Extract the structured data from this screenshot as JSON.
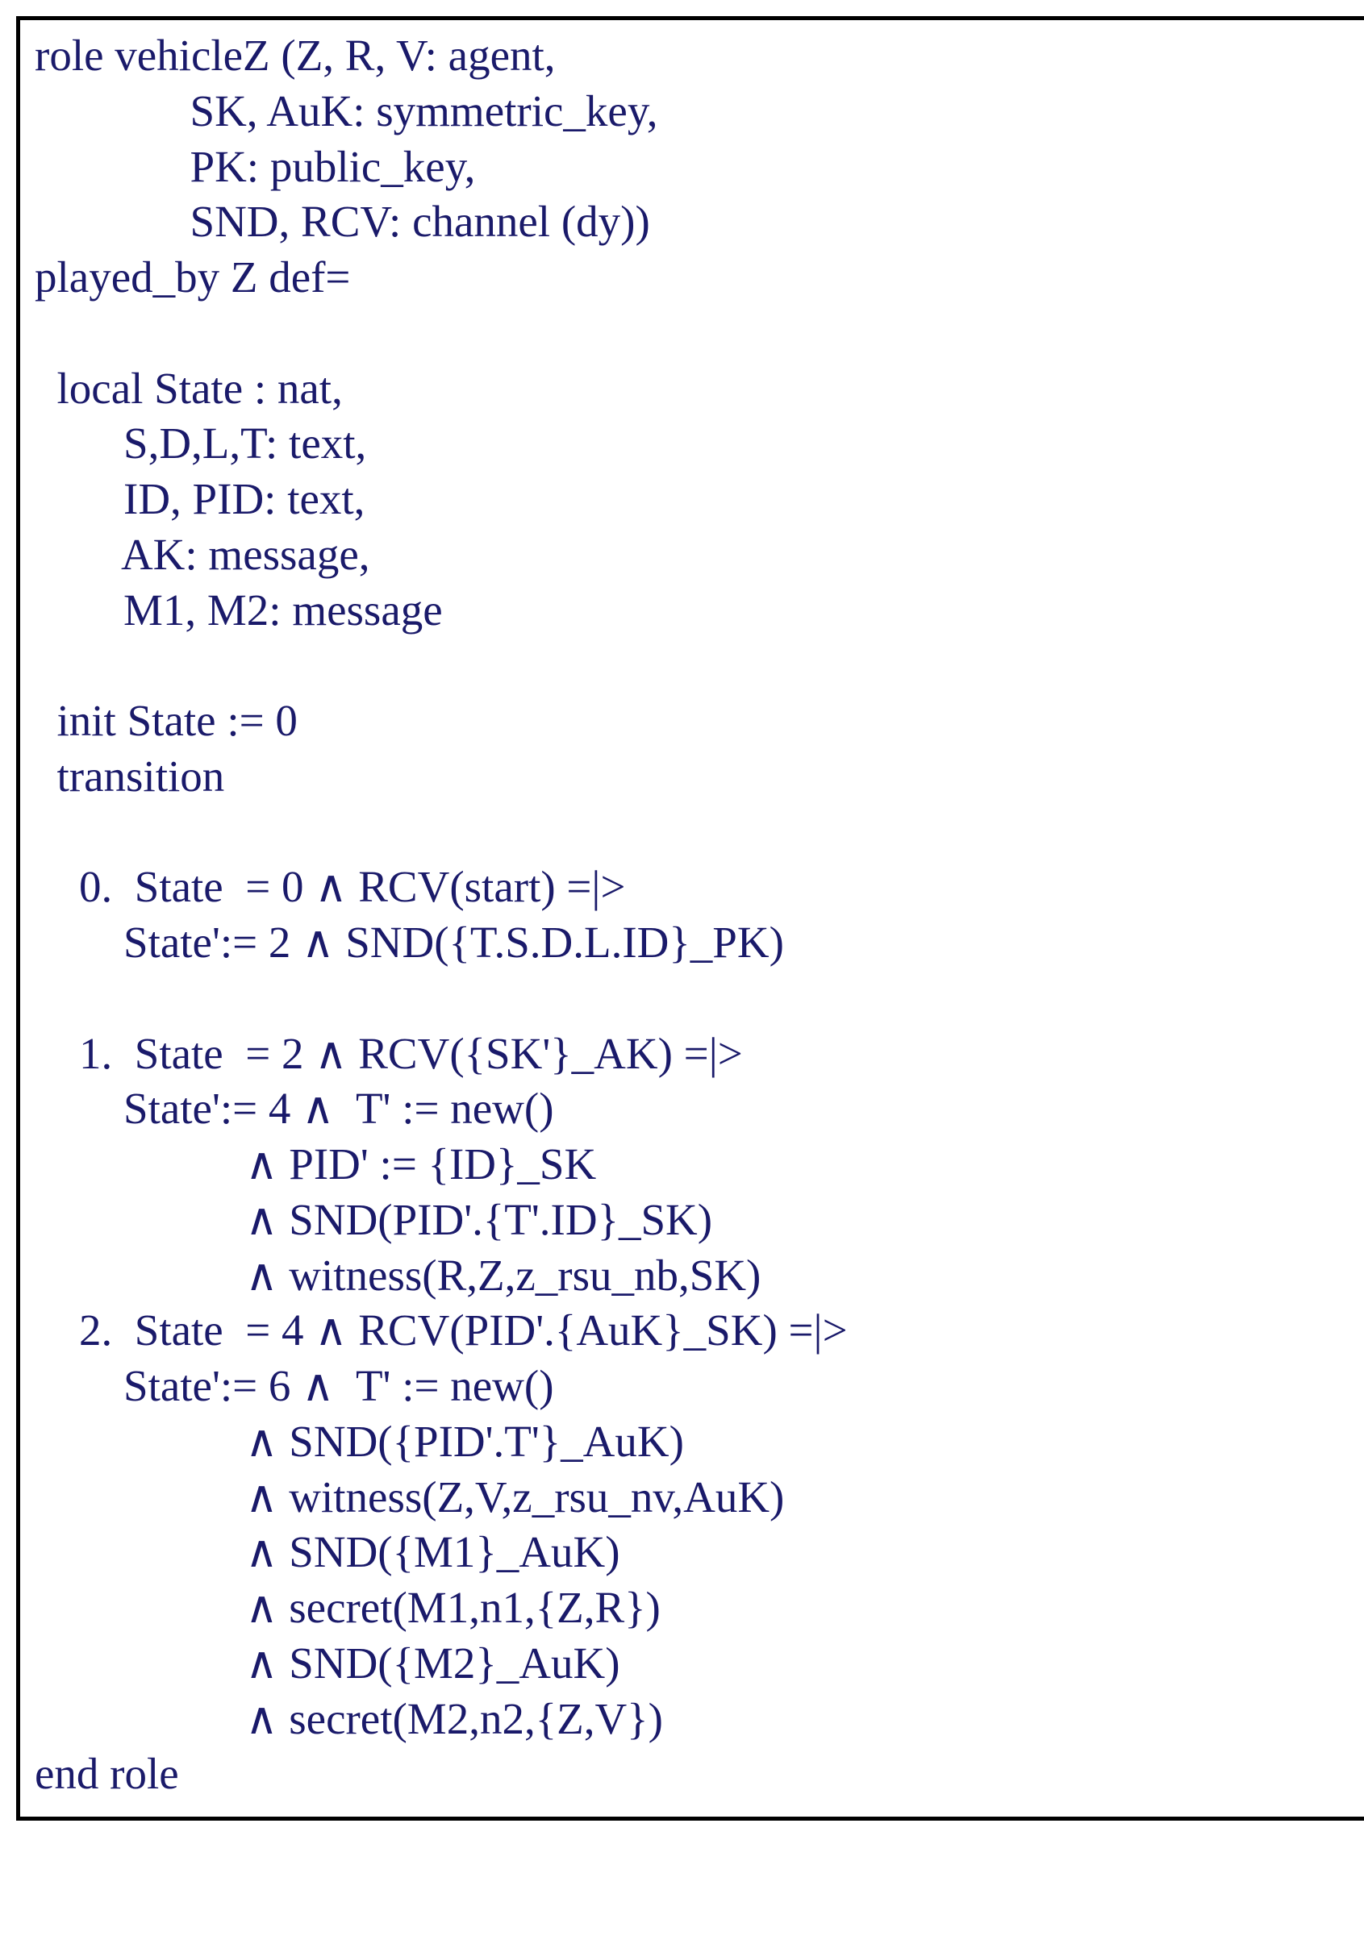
{
  "code": "role vehicleZ (Z, R, V: agent,\n              SK, AuK: symmetric_key,\n              PK: public_key,\n              SND, RCV: channel (dy))\nplayed_by Z def=\n\n  local State : nat,\n        S,D,L,T: text,\n        ID, PID: text,\n        AK: message,\n        M1, M2: message\n\n  init State := 0\n  transition\n\n    0.  State  = 0 ∧ RCV(start) =|>\n        State':= 2 ∧ SND({T.S.D.L.ID}_PK)\n\n    1.  State  = 2 ∧ RCV({SK'}_AK) =|>\n        State':= 4 ∧  T' := new()\n                   ∧ PID' := {ID}_SK\n                   ∧ SND(PID'.{T'.ID}_SK)\n                   ∧ witness(R,Z,z_rsu_nb,SK)\n    2.  State  = 4 ∧ RCV(PID'.{AuK}_SK) =|>\n        State':= 6 ∧  T' := new()\n                   ∧ SND({PID'.T'}_AuK)\n                   ∧ witness(Z,V,z_rsu_nv,AuK)\n                   ∧ SND({M1}_AuK)\n                   ∧ secret(M1,n1,{Z,R})\n                   ∧ SND({M2}_AuK)\n                   ∧ secret(M2,n2,{Z,V})\nend role"
}
